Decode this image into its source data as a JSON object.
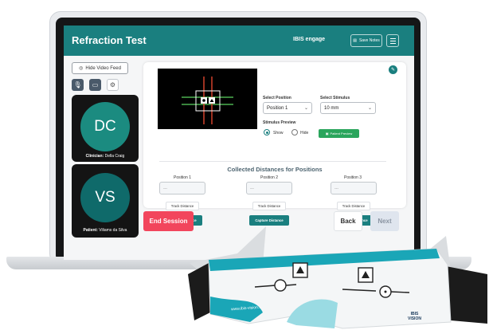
{
  "app": {
    "title": "Refraction Test",
    "logo_text": "IBIS engage",
    "notes_label": "Save Notes",
    "colors": {
      "primary": "#1a7f7f",
      "danger": "#f2455c",
      "preview": "#2aa55c"
    }
  },
  "video": {
    "hide_label": "Hide Video Feed",
    "controls": [
      {
        "icon": "microphone-icon"
      },
      {
        "icon": "camera-off-icon"
      },
      {
        "icon": "settings-icon"
      }
    ],
    "clinician": {
      "initials": "DC",
      "role": "Clinician:",
      "name": "Della Craig",
      "color": "#1b8b80"
    },
    "patient": {
      "initials": "VS",
      "role": "Patient:",
      "name": "Viliams da Silva",
      "color": "#0f6a6a"
    }
  },
  "stimulus": {
    "position_label": "Select Position",
    "position_value": "Position 1",
    "stimulus_label": "Select Stimulus",
    "stimulus_value": "10 mm",
    "preview_label": "Stimulus Preview",
    "show_label": "Show",
    "hide_label": "Hide",
    "preview_selected": "Show",
    "patient_preview_label": "Patient Preview"
  },
  "distances": {
    "title": "Collected Distances for Positions",
    "input_placeholder": "---",
    "track_label": "Track Distance",
    "capture_label": "Capture Distance",
    "positions": [
      {
        "label": "Position 1"
      },
      {
        "label": "Position 2"
      },
      {
        "label": "Position 3"
      }
    ]
  },
  "footer": {
    "end_label": "End Session",
    "back_label": "Back",
    "next_label": "Next"
  },
  "glasses": {
    "url_text": "www.ibis-vision...",
    "brand_line1": "IBIS",
    "brand_line2": "VISION"
  }
}
